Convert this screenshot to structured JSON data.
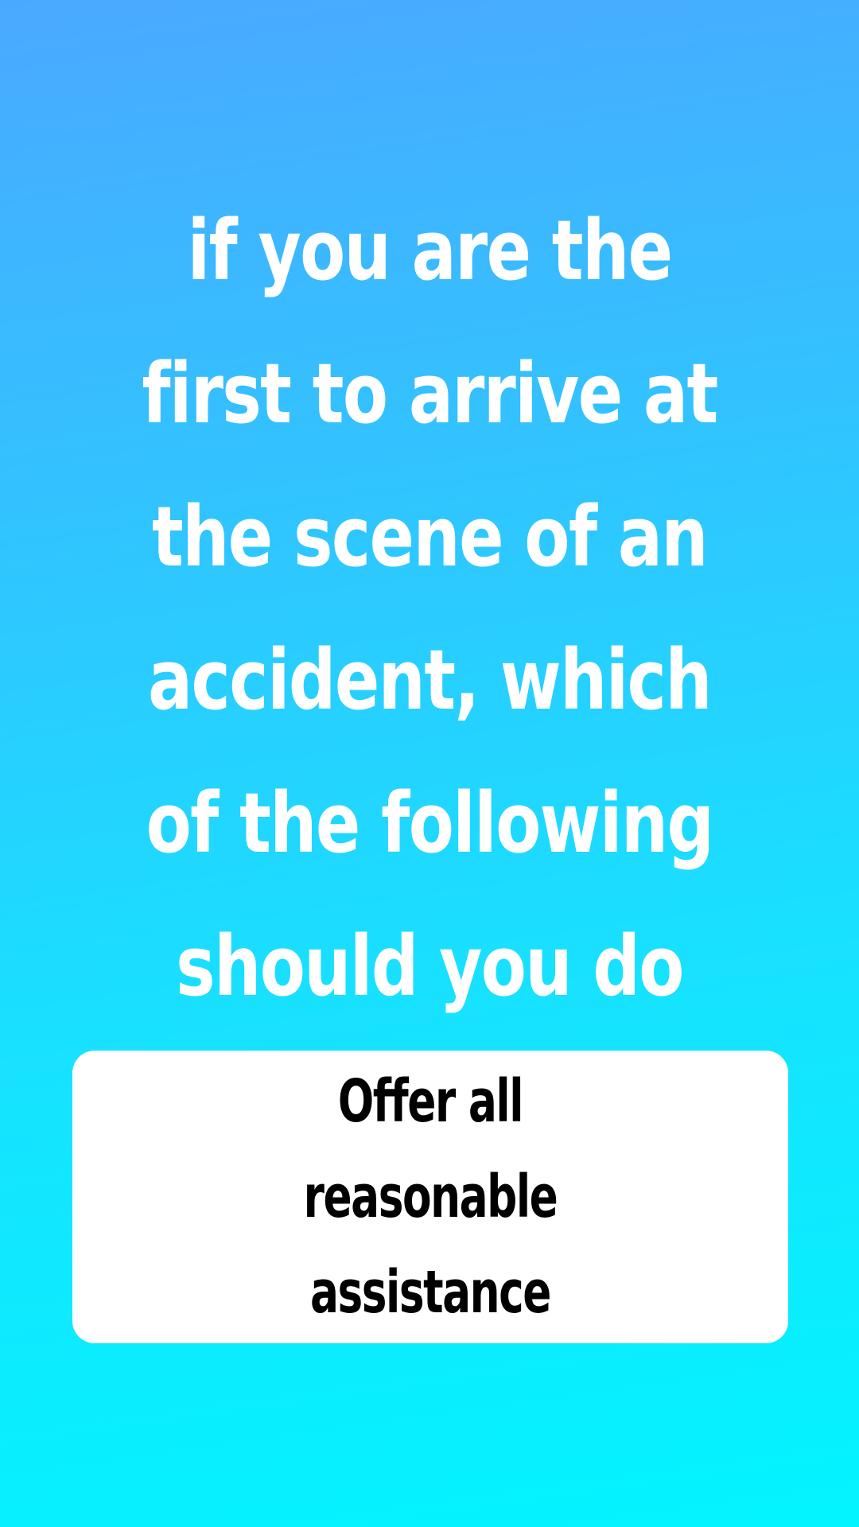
{
  "question": {
    "text": "if you are the first to arrive at the scene of an accident, which of the following should you do"
  },
  "answer": {
    "label": "Offer all reasonable assistance"
  },
  "colors": {
    "background_top": "#4aa9ff",
    "background_bottom": "#02f4ff",
    "question_text": "#ffffff",
    "card_background": "#ffffff",
    "answer_text": "#000000"
  }
}
